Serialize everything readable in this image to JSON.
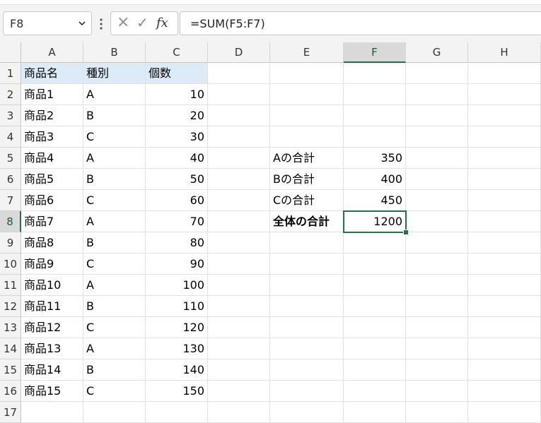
{
  "name_box": {
    "value": "F8"
  },
  "formula_bar": {
    "cancel_icon": "×",
    "enter_icon": "✓",
    "fx_label": "fx",
    "value": "=SUM(F5:F7)"
  },
  "columns": [
    "A",
    "B",
    "C",
    "D",
    "E",
    "F",
    "G",
    "H"
  ],
  "selected_column": "F",
  "selected_row": "8",
  "rows": [
    {
      "n": "1",
      "A": "商品名",
      "B": "種別",
      "C": "個数",
      "E": "",
      "F": ""
    },
    {
      "n": "2",
      "A": "商品1",
      "B": "A",
      "C": "10",
      "E": "",
      "F": ""
    },
    {
      "n": "3",
      "A": "商品2",
      "B": "B",
      "C": "20",
      "E": "",
      "F": ""
    },
    {
      "n": "4",
      "A": "商品3",
      "B": "C",
      "C": "30",
      "E": "",
      "F": ""
    },
    {
      "n": "5",
      "A": "商品4",
      "B": "A",
      "C": "40",
      "E": "Aの合計",
      "F": "350"
    },
    {
      "n": "6",
      "A": "商品5",
      "B": "B",
      "C": "50",
      "E": "Bの合計",
      "F": "400"
    },
    {
      "n": "7",
      "A": "商品6",
      "B": "C",
      "C": "60",
      "E": "Cの合計",
      "F": "450"
    },
    {
      "n": "8",
      "A": "商品7",
      "B": "A",
      "C": "70",
      "E": "全体の合計",
      "F": "1200"
    },
    {
      "n": "9",
      "A": "商品8",
      "B": "B",
      "C": "80",
      "E": "",
      "F": ""
    },
    {
      "n": "10",
      "A": "商品9",
      "B": "C",
      "C": "90",
      "E": "",
      "F": ""
    },
    {
      "n": "11",
      "A": "商品10",
      "B": "A",
      "C": "100",
      "E": "",
      "F": ""
    },
    {
      "n": "12",
      "A": "商品11",
      "B": "B",
      "C": "110",
      "E": "",
      "F": ""
    },
    {
      "n": "13",
      "A": "商品12",
      "B": "C",
      "C": "120",
      "E": "",
      "F": ""
    },
    {
      "n": "14",
      "A": "商品13",
      "B": "A",
      "C": "130",
      "E": "",
      "F": ""
    },
    {
      "n": "15",
      "A": "商品14",
      "B": "B",
      "C": "140",
      "E": "",
      "F": ""
    },
    {
      "n": "16",
      "A": "商品15",
      "B": "C",
      "C": "150",
      "E": "",
      "F": ""
    },
    {
      "n": "17",
      "A": "",
      "B": "",
      "C": "",
      "E": "",
      "F": ""
    }
  ],
  "colors": {
    "accent": "#217346",
    "header_fill": "#dcebf7"
  }
}
